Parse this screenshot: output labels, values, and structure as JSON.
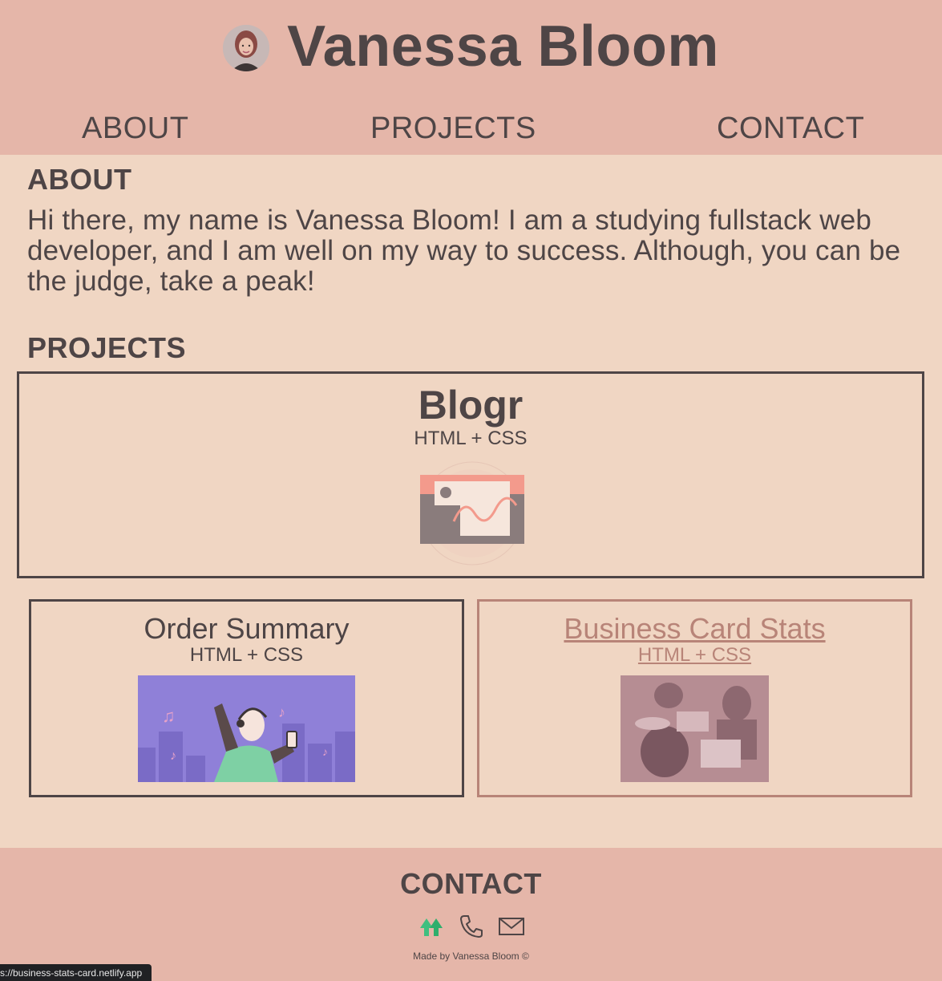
{
  "header": {
    "title": "Vanessa Bloom",
    "nav": [
      "ABOUT",
      "PROJECTS",
      "CONTACT"
    ]
  },
  "about": {
    "heading": "ABOUT",
    "text": "Hi there, my name is Vanessa Bloom! I am a studying fullstack web developer, and I am well on my way to success. Although, you can be the judge, take a peak!"
  },
  "projects": {
    "heading": "PROJECTS",
    "items": [
      {
        "title": "Blogr",
        "tech": "HTML + CSS",
        "icon": "blogr-illustration"
      },
      {
        "title": "Order Summary",
        "tech": "HTML + CSS",
        "icon": "music-illustration"
      },
      {
        "title": "Business Card Stats",
        "tech": "HTML + CSS",
        "icon": "office-photo"
      }
    ]
  },
  "contact": {
    "heading": "CONTACT",
    "icons": [
      "upwork-icon",
      "phone-icon",
      "mail-icon"
    ],
    "credit": "Made by Vanessa Bloom ©"
  },
  "status_bar": {
    "url": "s://business-stats-card.netlify.app"
  },
  "colors": {
    "header_bg": "#e5b6a9",
    "body_bg": "#f0d6c3",
    "text": "#4e4546",
    "link_accent": "#b88478"
  }
}
